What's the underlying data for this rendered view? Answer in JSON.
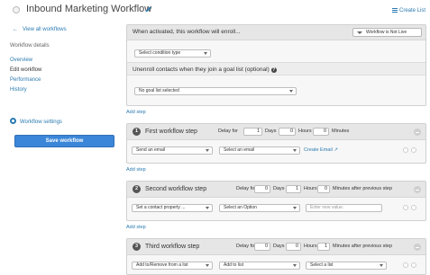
{
  "header": {
    "title": "Inbound Marketing Workflow",
    "create_list": "Create List"
  },
  "sidebar": {
    "back": "View all workflows",
    "section_label": "Workflow details",
    "items": [
      {
        "label": "Overview"
      },
      {
        "label": "Edit workflow"
      },
      {
        "label": "Performance"
      },
      {
        "label": "History"
      }
    ],
    "settings": "Workflow settings",
    "save": "Save workflow"
  },
  "enroll": {
    "text": "When activated, this workflow will enroll...",
    "status": "Workflow is Not Live",
    "condition_placeholder": "Select condition type",
    "unenroll_text": "Unenroll contacts when they join a goal list (optional)",
    "goal_list": "No goal list selected"
  },
  "add_step": "Add step",
  "delay_label": "Delay for",
  "days_label": "Days",
  "hours_label": "Hours",
  "minutes_label": "Minutes",
  "minutes_after_label": "Minutes after previous step",
  "steps": [
    {
      "number": "1",
      "title": "First workflow step",
      "days": "1",
      "hours": "0",
      "minutes": "0",
      "action": "Send an email",
      "option": "Select an email",
      "link": "Create Email"
    },
    {
      "number": "2",
      "title": "Second workflow step",
      "days": "0",
      "hours": "1",
      "minutes": "0",
      "action": "Set a contact property ...",
      "option": "Select an Option",
      "placeholder": "Enter new value."
    },
    {
      "number": "3",
      "title": "Third workflow step",
      "days": "0",
      "hours": "0",
      "minutes": "1",
      "action": "Add to/Remove from a list",
      "option": "Add to list",
      "list": "Select a list"
    }
  ]
}
